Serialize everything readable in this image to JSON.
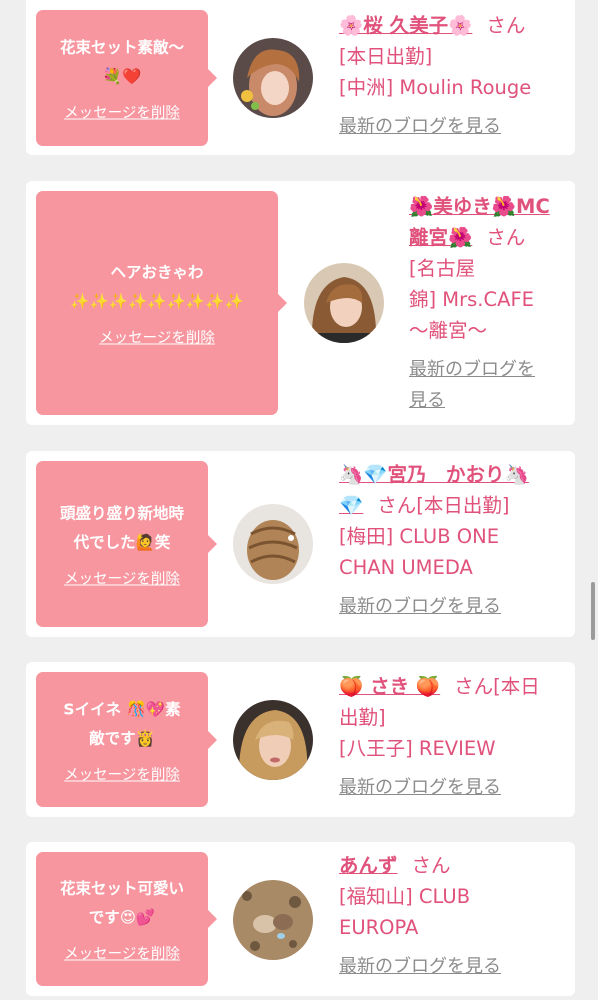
{
  "cards": [
    {
      "message": "花束セット素敵〜\n💐❤️",
      "delete_label": "メッセージを削除",
      "name": "🌸桜 久美子🌸",
      "honorific": "さん",
      "status": "[本日出勤]",
      "shop": "[中洲] Moulin Rouge",
      "blog_label": "最新のブログを見る",
      "avatar_icon": "avatar-photo"
    },
    {
      "message": "ヘアおきゃわ\n✨✨✨✨✨✨✨✨✨",
      "delete_label": "メッセージを削除",
      "name": "🌺美ゆき🌺MC\n離宮🌺",
      "honorific": "さん",
      "status": "",
      "shop": "[名古屋\n錦] Mrs.CAFE\n〜離宮〜",
      "blog_label": "最新のブログを\n見る",
      "avatar_icon": "avatar-photo"
    },
    {
      "message": "頭盛り盛り新地時\n代でした🙋笑",
      "delete_label": "メッセージを削除",
      "name": "🦄💎宮乃　かおり🦄\n💎",
      "honorific": "さん",
      "status": "[本日出勤]",
      "shop": "[梅田] CLUB ONE\nCHAN UMEDA",
      "blog_label": "最新のブログを見る",
      "avatar_icon": "avatar-photo"
    },
    {
      "message": "Sイイネ 🎊💖素\n敵です👸",
      "delete_label": "メッセージを削除",
      "name": "🍑 さき 🍑",
      "honorific": "さん",
      "status": "[本日\n出勤]",
      "shop": "[八王子] REVIEW",
      "blog_label": "最新のブログを見る",
      "avatar_icon": "avatar-photo"
    },
    {
      "message": "花束セット可愛い\nです😍💕",
      "delete_label": "メッセージを削除",
      "name": "あんず",
      "honorific": "さん",
      "status": "",
      "shop": "[福知山] CLUB\nEUROPA",
      "blog_label": "最新のブログを見る",
      "avatar_icon": "avatar-photo"
    }
  ],
  "colors": {
    "bubble": "#f7969f",
    "name": "#e0527b",
    "link_gray": "#8c8c8c",
    "background": "#efefef"
  }
}
